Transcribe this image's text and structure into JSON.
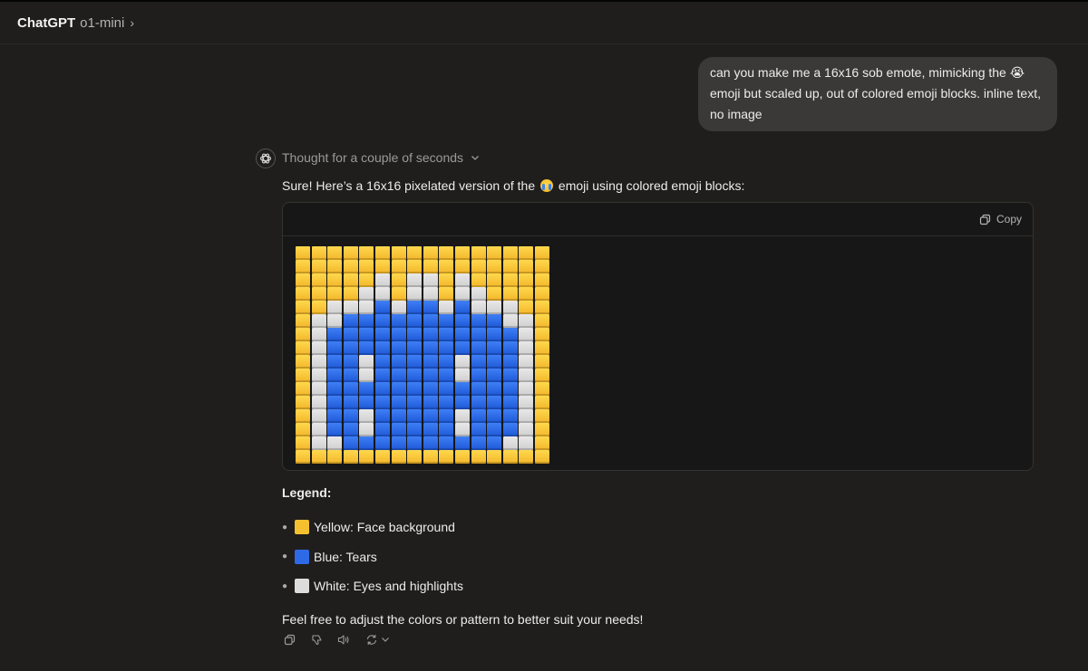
{
  "topbar": {
    "app_name": "ChatGPT",
    "model_name": "o1-mini",
    "chevron": "›"
  },
  "user_message": {
    "text": "can you make me a 16x16 sob emote, mimicking the 😭 emoji but scaled up, out of colored emoji blocks. inline text, no image"
  },
  "assistant": {
    "thought_label": "Thought for a couple of seconds",
    "intro_before": "Sure! Here’s a 16x16 pixelated version of the ",
    "intro_after": " emoji using colored emoji blocks:",
    "code": {
      "copy_label": "Copy",
      "pixel_rows": [
        "YYYYYYYYYYYYYYYY",
        "YYYYYYYYYYYYYYYY",
        "YYYYYWYWWYWYYYYY",
        "YYYYWWYWWYWWYYYY",
        "YYWWWBWBBWBWWWYY",
        "YWWBBBBBBBBBBWWY",
        "YWBBBBBBBBBBBBWY",
        "YWBBBBBBBBBBBBWY",
        "YWBBWBBBBBWBBBWY",
        "YWBBWBBBBBWBBBWY",
        "YWBBBBBBBBBBBBWY",
        "YWBBBBBBBBBBBBWY",
        "YWBBWBBBBBWBBBWY",
        "YWBBWBBBBBWBBBWY",
        "YWWBBBBBBBBBBWWY",
        "YYYYYYYYYYYYYYYY"
      ],
      "colors": {
        "Y": "#f5c02f",
        "B": "#2f6ae6",
        "W": "#dcdcdc"
      }
    },
    "legend_title": "Legend:",
    "legend_items": [
      {
        "swatch": "#f5c02f",
        "label": "Yellow: Face background"
      },
      {
        "swatch": "#2f6ae6",
        "label": "Blue: Tears"
      },
      {
        "swatch": "#dcdcdc",
        "label": "White: Eyes and highlights"
      }
    ],
    "outro": "Feel free to adjust the colors or pattern to better suit your needs!",
    "action_icons": [
      "copy-icon",
      "thumbs-down-icon",
      "speaker-icon",
      "regenerate-icon",
      "chevron-down-icon"
    ]
  }
}
